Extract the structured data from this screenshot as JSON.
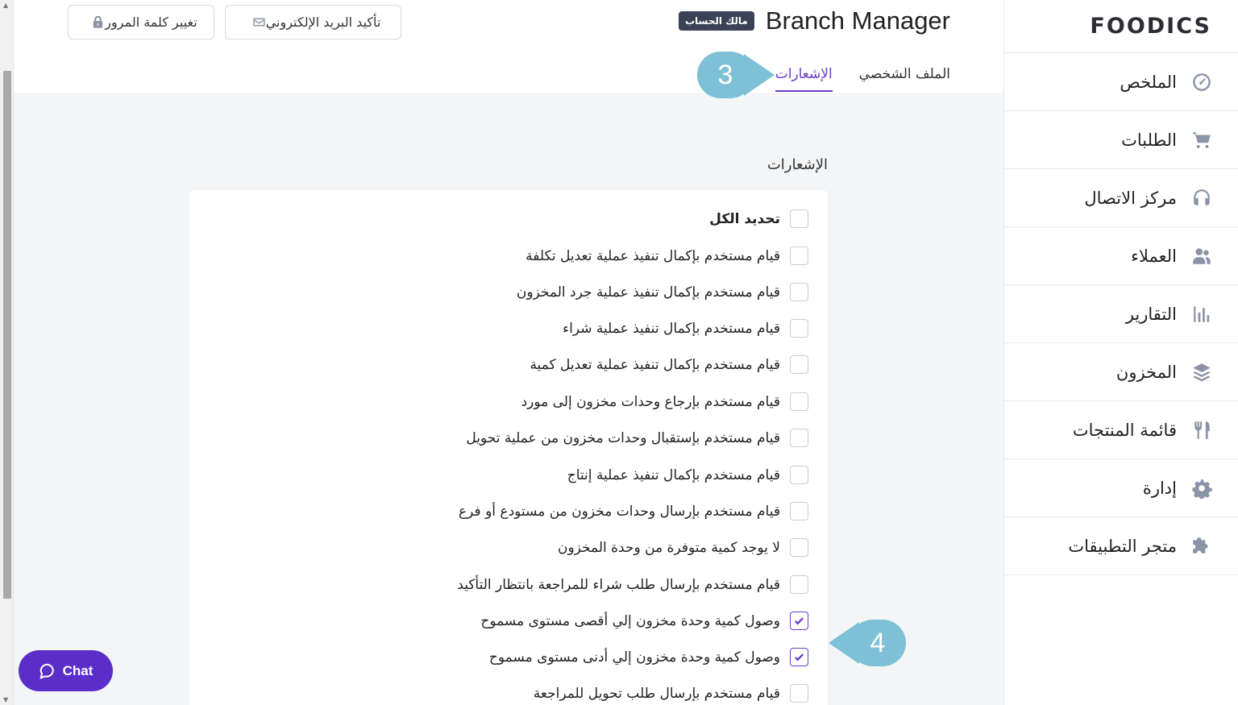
{
  "brand": {
    "logo_text": "FOODICS"
  },
  "sidebar": {
    "items": [
      {
        "label": "الملخص",
        "icon": "dashboard-gauge-icon"
      },
      {
        "label": "الطلبات",
        "icon": "cart-icon"
      },
      {
        "label": "مركز الاتصال",
        "icon": "headset-icon"
      },
      {
        "label": "العملاء",
        "icon": "users-icon"
      },
      {
        "label": "التقارير",
        "icon": "bar-chart-icon"
      },
      {
        "label": "المخزون",
        "icon": "layers-icon"
      },
      {
        "label": "قائمة المنتجات",
        "icon": "utensils-icon"
      },
      {
        "label": "إدارة",
        "icon": "gear-icon"
      },
      {
        "label": "متجر التطبيقات",
        "icon": "puzzle-icon"
      }
    ]
  },
  "header": {
    "title": "Branch Manager",
    "badge": "مالك الحساب",
    "change_password": "تغيير كلمة المرور",
    "confirm_email": "تأكيد البريد الإلكتروني",
    "tabs": [
      {
        "label": "الملف الشخصي",
        "active": false
      },
      {
        "label": "الإشعارات",
        "active": true
      }
    ]
  },
  "section": {
    "title": "الإشعارات"
  },
  "notifications": {
    "select_all": "تحديد الكل",
    "items": [
      {
        "label": "قيام مستخدم بإكمال تنفيذ عملية تعديل تكلفة",
        "checked": false
      },
      {
        "label": "قيام مستخدم بإكمال تنفيذ عملية جرد المخزون",
        "checked": false
      },
      {
        "label": "قيام مستخدم بإكمال تنفيذ عملية شراء",
        "checked": false
      },
      {
        "label": "قيام مستخدم بإكمال تنفيذ عملية تعديل كمية",
        "checked": false
      },
      {
        "label": "قيام مستخدم بإرجاع وحدات مخزون إلى مورد",
        "checked": false
      },
      {
        "label": "قيام مستخدم بإستقبال وحدات مخزون من عملية تحويل",
        "checked": false
      },
      {
        "label": "قيام مستخدم بإكمال تنفيذ عملية إنتاج",
        "checked": false
      },
      {
        "label": "قيام مستخدم بإرسال وحدات مخزون من مستودع أو فرع",
        "checked": false
      },
      {
        "label": "لا يوجد كمية متوفرة من وحدة المخزون",
        "checked": false
      },
      {
        "label": "قيام مستخدم بإرسال طلب شراء للمراجعة بانتظار التأكيد",
        "checked": false
      },
      {
        "label": "وصول كمية وحدة مخزون إلي أقصى مستوى مسموح",
        "checked": true
      },
      {
        "label": "وصول كمية وحدة مخزون إلي أدنى مستوى مسموح",
        "checked": true
      },
      {
        "label": "قيام مستخدم بإرسال طلب تحويل للمراجعة",
        "checked": false
      }
    ]
  },
  "callouts": {
    "step3": "3",
    "step4": "4"
  },
  "chat": {
    "label": "Chat"
  },
  "colors": {
    "accent": "#6c3bc9",
    "callout": "#7ec0d6",
    "chat": "#5b2dc9"
  }
}
